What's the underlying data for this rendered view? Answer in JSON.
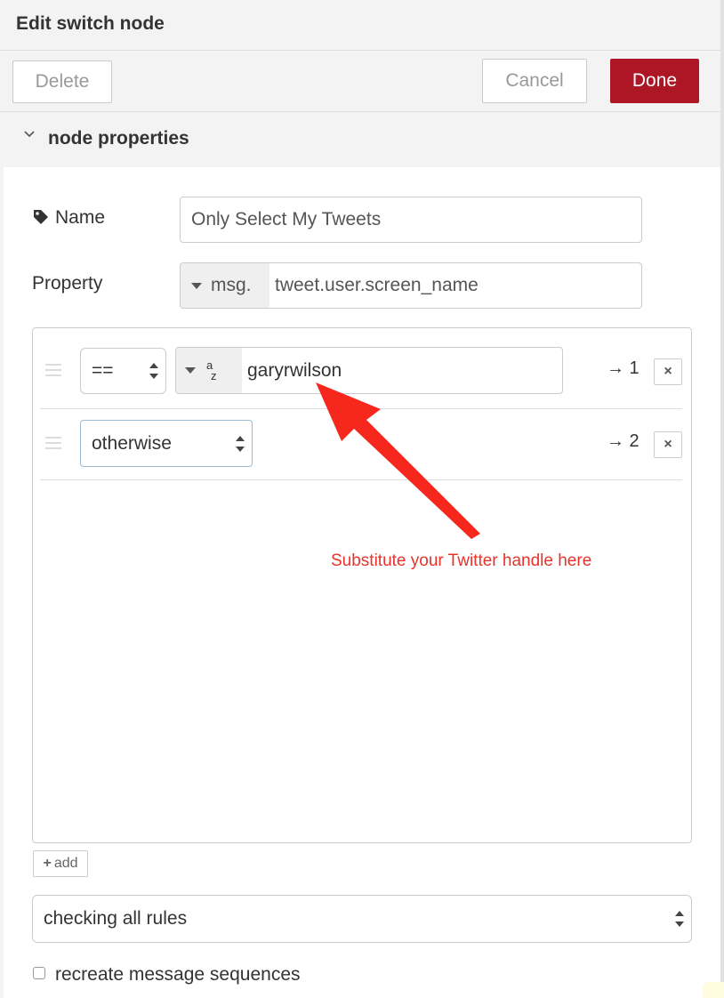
{
  "header": {
    "title": "Edit switch node"
  },
  "toolbar": {
    "delete_label": "Delete",
    "cancel_label": "Cancel",
    "done_label": "Done"
  },
  "section": {
    "title": "node properties"
  },
  "name_field": {
    "label": "Name",
    "value": "Only Select My Tweets"
  },
  "property_field": {
    "label": "Property",
    "type_label": "msg.",
    "value": "tweet.user.screen_name"
  },
  "rules": [
    {
      "operator": "==",
      "type_icon_top": "a",
      "type_icon_bottom": "z",
      "value": "garyrwilson",
      "output": "→ 1",
      "remove": "×"
    },
    {
      "operator": "otherwise",
      "output": "→ 2",
      "remove": "×"
    }
  ],
  "add_button": {
    "icon": "+",
    "label": "add"
  },
  "checking_select": {
    "value": "checking all rules"
  },
  "recreate_checkbox": {
    "label": "recreate message sequences",
    "checked": false
  },
  "annotation": {
    "text": "Substitute your Twitter handle here",
    "color": "#e8332b"
  },
  "colors": {
    "done_button": "#ad1625",
    "tray_background": "#f3f3f3"
  }
}
